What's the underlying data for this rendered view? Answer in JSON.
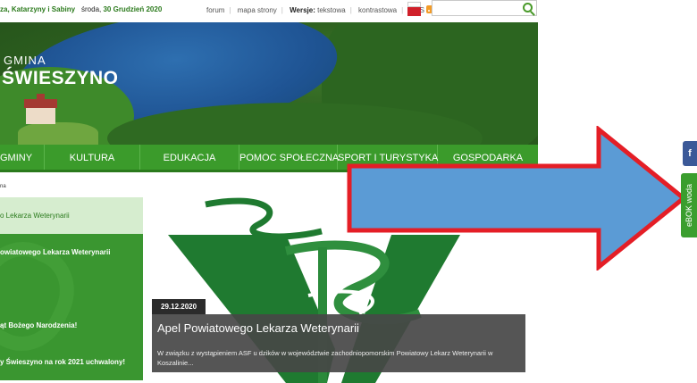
{
  "topbar": {
    "names": "za, Katarzyny i Sabiny",
    "date_prefix": "środa, ",
    "date_value": "30 Grudzień 2020",
    "links": [
      "forum",
      "mapa strony"
    ],
    "version_label": "Wersje:",
    "version_text": "tekstowa",
    "contrast": "kontrastowa",
    "rss": "RSS"
  },
  "search": {
    "placeholder": ""
  },
  "banner": {
    "title_small": "GMINA",
    "title_big": "ŚWIESZYNO",
    "slider": {
      "count": 8,
      "active_index": 1
    }
  },
  "nav": {
    "items": [
      "GMINY",
      "KULTURA",
      "EDUKACJA",
      "POMOC SPOŁECZNA",
      "SPORT I TURYSTYKA",
      "GOSPODARKA"
    ]
  },
  "breadcrumb": "na",
  "sidebar": {
    "active": "o Lekarza Weterynarii",
    "items": [
      "owiatowego Lekarza Weterynarii",
      "ąt Bożego Narodzenia!",
      "y Świeszyno na rok 2021 uchwalony!"
    ]
  },
  "feature": {
    "date": "29.12.2020",
    "title": "Apel Powiatowego Lekarza Weterynarii",
    "excerpt": "W związku z wystąpieniem ASF u dzików w województwie zachodniopomorskim Powiatowy Lekarz Weterynarii w Koszalinie..."
  },
  "side_tabs": {
    "facebook": "f",
    "ebok": "eBOK woda"
  },
  "colors": {
    "brand_green": "#3b9b2b",
    "arrow_fill": "#5b9bd5",
    "arrow_stroke": "#e41e26"
  }
}
